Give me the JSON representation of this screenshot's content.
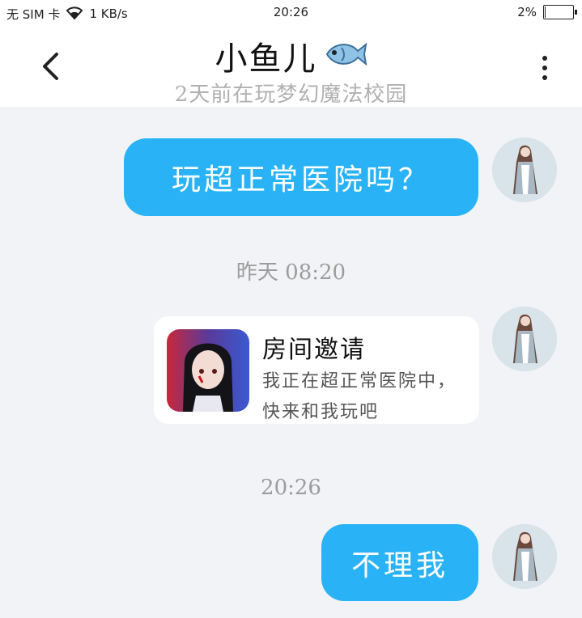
{
  "status_bar": {
    "carrier": "无 SIM 卡",
    "speed": "1 KB/s",
    "time": "20:26",
    "battery": "2%",
    "battery_level": 0.02
  },
  "header": {
    "title": "小鱼儿",
    "title_emoji": "🐟",
    "subtitle": "2天前在玩梦幻魔法校园",
    "back_icon": "chevron-left-icon",
    "more_icon": "more-vertical-icon"
  },
  "messages": [
    {
      "type": "text",
      "text": "玩超正常医院吗？"
    },
    {
      "type": "timestamp",
      "text": "昨天 08:20"
    },
    {
      "type": "card",
      "title": "房间邀请",
      "desc": "我正在超正常医院中，快来和我玩吧"
    },
    {
      "type": "timestamp",
      "text": "20:26"
    },
    {
      "type": "text",
      "text": "不理我"
    }
  ],
  "colors": {
    "bubble": "#29b3f6",
    "background": "#f1f3f6",
    "card": "#ffffff"
  }
}
